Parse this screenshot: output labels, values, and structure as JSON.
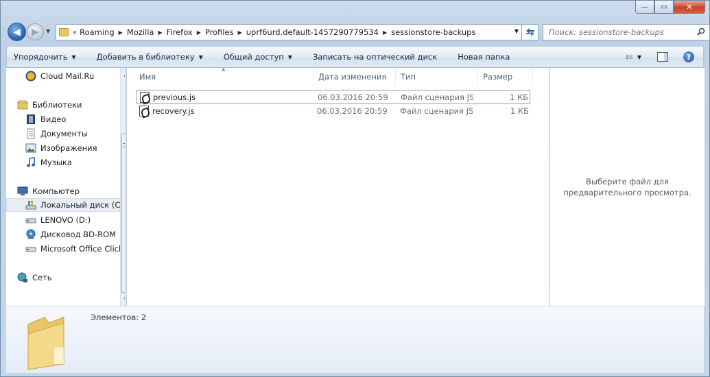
{
  "window": {
    "caption_buttons": {
      "minimize": "—",
      "maximize": "▭",
      "close": "✕"
    }
  },
  "navigation": {
    "back_icon": "back-arrow-icon",
    "forward_icon": "forward-arrow-icon",
    "breadcrumb_prefix": "«",
    "breadcrumbs": [
      "Roaming",
      "Mozilla",
      "Firefox",
      "Profiles",
      "uprf6urd.default-1457290779534",
      "sessionstore-backups"
    ],
    "search_placeholder": "Поиск: sessionstore-backups"
  },
  "toolbar": {
    "items": [
      {
        "label": "Упорядочить",
        "has_dropdown": true
      },
      {
        "label": "Добавить в библиотеку",
        "has_dropdown": true
      },
      {
        "label": "Общий доступ",
        "has_dropdown": true
      },
      {
        "label": "Записать на оптический диск",
        "has_dropdown": false
      },
      {
        "label": "Новая папка",
        "has_dropdown": false
      }
    ],
    "help_label": "?"
  },
  "sidebar": {
    "items": [
      {
        "label": "Cloud Mail.Ru",
        "icon": "cloud-mail-icon"
      },
      {
        "label": "Библиотеки",
        "icon": "libraries-icon"
      },
      {
        "label": "Видео",
        "icon": "video-icon"
      },
      {
        "label": "Документы",
        "icon": "documents-icon"
      },
      {
        "label": "Изображения",
        "icon": "images-icon"
      },
      {
        "label": "Музыка",
        "icon": "music-icon"
      },
      {
        "label": "Компьютер",
        "icon": "computer-icon"
      },
      {
        "label": "Локальный диск (C:)",
        "icon": "local-disk-icon",
        "selected": true
      },
      {
        "label": "LENOVO (D:)",
        "icon": "drive-icon"
      },
      {
        "label": "Дисковод BD-ROM",
        "icon": "bd-rom-icon"
      },
      {
        "label": "Microsoft Office Click-to-Run",
        "icon": "drive-icon"
      },
      {
        "label": "Сеть",
        "icon": "network-icon"
      }
    ]
  },
  "file_list": {
    "columns": [
      "Имя",
      "Дата изменения",
      "Тип",
      "Размер"
    ],
    "rows": [
      {
        "name": "previous.js",
        "date": "06.03.2016 20:59",
        "type": "Файл сценария JS...",
        "size": "1 КБ"
      },
      {
        "name": "recovery.js",
        "date": "06.03.2016 20:59",
        "type": "Файл сценария JS...",
        "size": "1 КБ"
      }
    ]
  },
  "preview": {
    "message": "Выберите файл для предварительного просмотра."
  },
  "details": {
    "items_count": "Элементов: 2"
  }
}
